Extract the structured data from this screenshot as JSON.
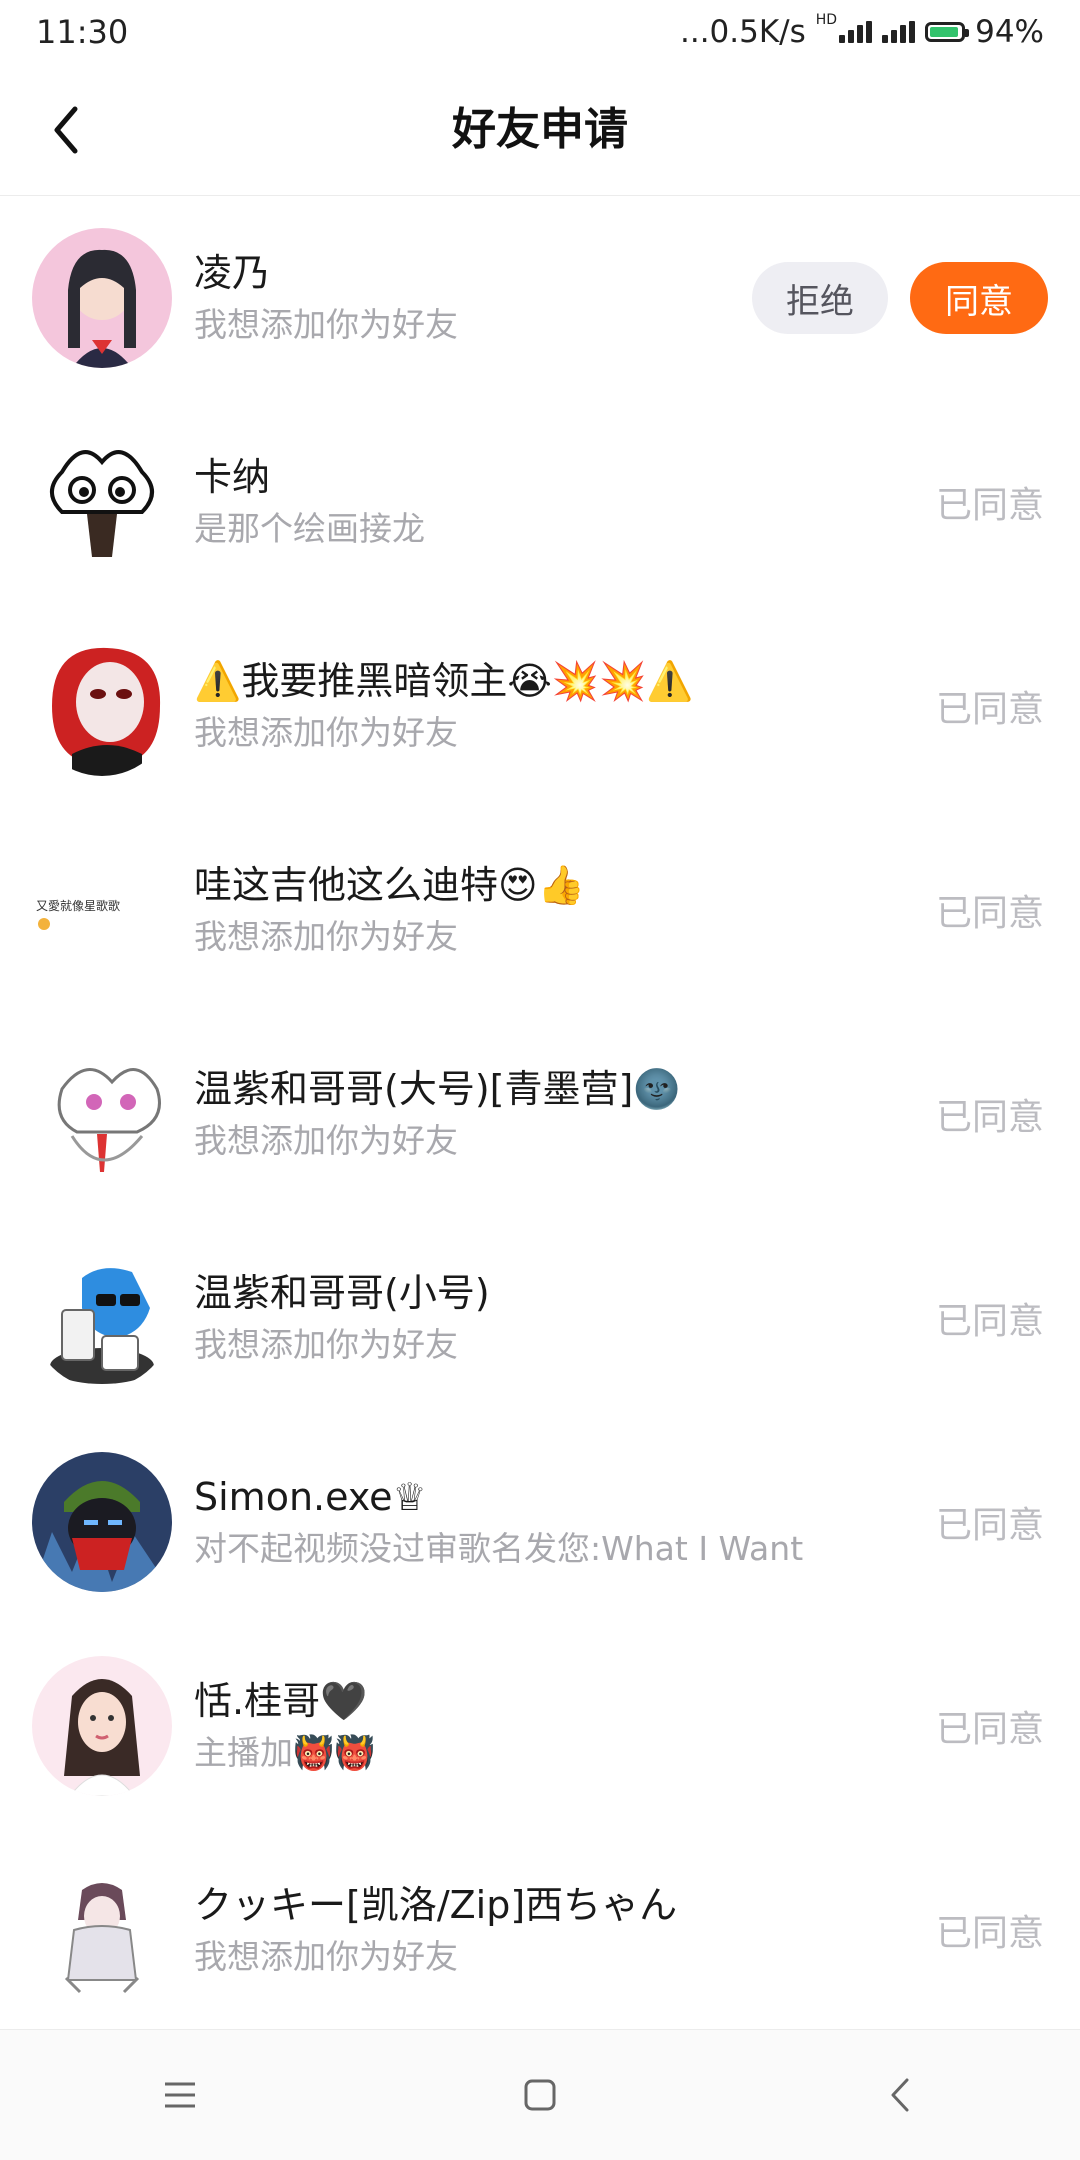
{
  "status_bar": {
    "time": "11:30",
    "network_speed": "...0.5K/s",
    "hd_label": "HD",
    "battery": "94%",
    "battery_level": 0.94
  },
  "header": {
    "title": "好友申请",
    "back_icon": "chevron-left-icon"
  },
  "requests": [
    {
      "name": "凌乃",
      "message": "我想添加你为好友",
      "status": "pending",
      "reject_label": "拒绝",
      "accept_label": "同意"
    },
    {
      "name": "卡纳",
      "message": "是那个绘画接龙",
      "status": "已同意"
    },
    {
      "name": "⚠️我要推黑暗领主😭💥💥⚠️",
      "message": "我想添加你为好友",
      "status": "已同意"
    },
    {
      "name": "哇这吉他这么迪特😍👍",
      "message": "我想添加你为好友",
      "status": "已同意"
    },
    {
      "name": "温紫和哥哥(大号)[青墨营]🌚",
      "message": "我想添加你为好友",
      "status": "已同意"
    },
    {
      "name": "温紫和哥哥(小号)",
      "message": "我想添加你为好友",
      "status": "已同意"
    },
    {
      "name": "Simon.exe♕",
      "message": "对不起视频没过审歌名发您:What I Want",
      "status": "已同意"
    },
    {
      "name": "恬.桂哥🖤",
      "message": "主播加👹👹",
      "status": "已同意"
    },
    {
      "name": "クッキー[凯洛/Zip]西ちゃん",
      "message": "我想添加你为好友",
      "status": "已同意"
    }
  ],
  "nav_bar": {
    "menu_icon": "menu-icon",
    "home_icon": "home-square-icon",
    "back_icon": "back-chevron-icon"
  },
  "colors": {
    "accent": "#ff6a13",
    "reject_bg": "#eeeef3",
    "muted_text": "#a8a8ad",
    "status_text": "#bcbcc1"
  }
}
